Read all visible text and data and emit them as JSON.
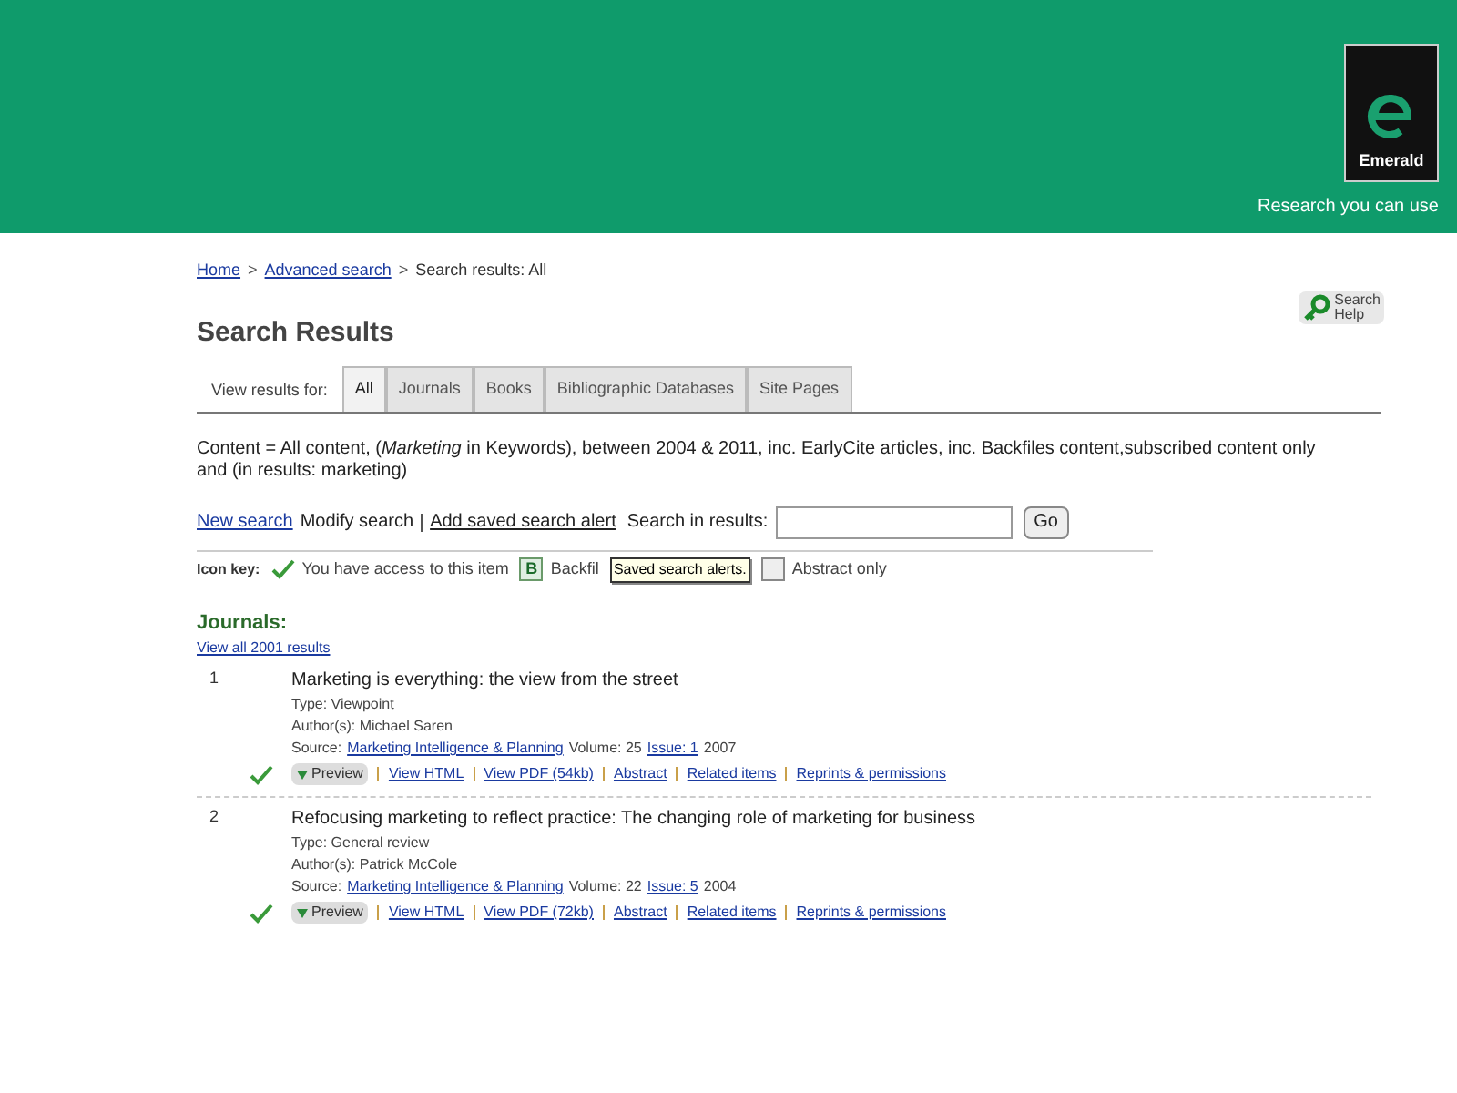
{
  "header": {
    "logo_text": "Emerald",
    "tagline": "Research you can use"
  },
  "breadcrumb": {
    "links": [
      "Home",
      "Advanced search"
    ],
    "current": "Search results: All"
  },
  "separator": ">",
  "title": "Search Results",
  "help_button": {
    "label_line1": "Search",
    "label_line2": "Help"
  },
  "tabs_label": "View results for:",
  "tabs": [
    {
      "label": "All",
      "selected": true
    },
    {
      "label": "Journals",
      "selected": false
    },
    {
      "label": "Books",
      "selected": false
    },
    {
      "label": "Bibliographic Databases",
      "selected": false
    },
    {
      "label": "Site Pages",
      "selected": false
    }
  ],
  "query": "Content = All content, (*Marketing* in Keywords), between 2004 & 2011, inc. EarlyCite articles, inc. Backfiles content,subscribed content only and (in results: marketing)",
  "actions": {
    "new_search": "New search",
    "modify_search": "Modify search",
    "add_alert": "Add saved search alert",
    "search_in_results_label": "Search in results:",
    "go": "Go"
  },
  "tooltip": "Saved search alerts.",
  "icon_key": {
    "label": "Icon key:",
    "items": [
      {
        "kind": "check",
        "text": "You have access to this item"
      },
      {
        "kind": "letter",
        "letter": "B",
        "text": "Backfil"
      },
      {
        "kind": "box",
        "text": "Abstract only"
      }
    ]
  },
  "section_title": "Journals:",
  "view_all": "View all 2001 results",
  "results": [
    {
      "number": "1",
      "title": "Marketing is everything: the view from the street",
      "type": "Type: Viewpoint",
      "authors": "Author(s): Michael Saren",
      "source_label": "Source:",
      "journal": "Marketing Intelligence & Planning",
      "volume": "Volume: 25",
      "issue": "Issue: 1",
      "year": "2007",
      "access": true,
      "preview": "Preview",
      "links": [
        "View HTML",
        "View PDF (54kb)",
        "Abstract",
        "Related items",
        "Reprints & permissions"
      ]
    },
    {
      "number": "2",
      "title": "Refocusing marketing to reflect practice: The changing role of marketing for business",
      "type": "Type: General review",
      "authors": "Author(s): Patrick McCole",
      "source_label": "Source:",
      "journal": "Marketing Intelligence & Planning",
      "volume": "Volume: 22",
      "issue": "Issue: 5",
      "year": "2004",
      "access": true,
      "preview": "Preview",
      "links": [
        "View HTML",
        "View PDF (72kb)",
        "Abstract",
        "Related items",
        "Reprints & permissions"
      ]
    }
  ]
}
